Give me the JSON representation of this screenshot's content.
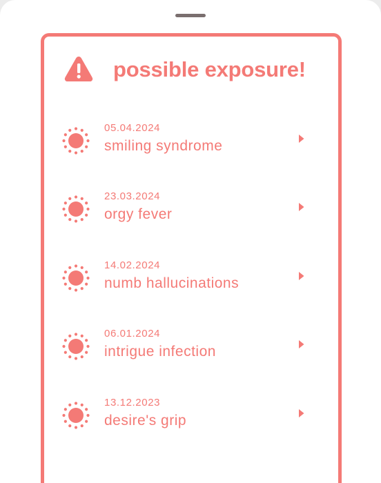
{
  "colors": {
    "accent": "#f47a76",
    "background": "#ffffff",
    "grabber": "#7a6f6f"
  },
  "header": {
    "icon": "warning-triangle-icon",
    "title": "possible exposure!"
  },
  "exposures": [
    {
      "date": "05.04.2024",
      "name": "smiling syndrome",
      "icon": "virus-icon"
    },
    {
      "date": "23.03.2024",
      "name": "orgy fever",
      "icon": "virus-icon"
    },
    {
      "date": "14.02.2024",
      "name": "numb hallucinations",
      "icon": "virus-icon"
    },
    {
      "date": "06.01.2024",
      "name": "intrigue infection",
      "icon": "virus-icon"
    },
    {
      "date": "13.12.2023",
      "name": "desire's grip",
      "icon": "virus-icon"
    }
  ]
}
